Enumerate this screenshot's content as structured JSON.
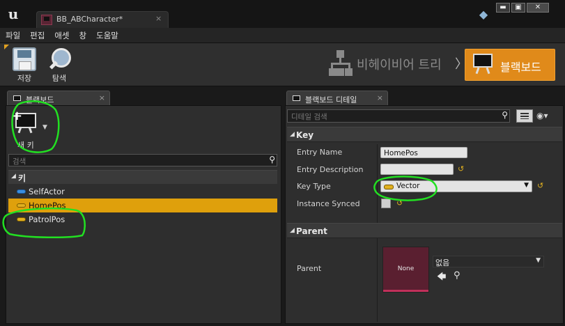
{
  "window": {
    "tab_title": "BB_ABCharacter*",
    "tab_close": "×",
    "logo": "u",
    "controls": [
      "▬",
      "▣",
      "✕"
    ]
  },
  "menu": [
    "파일",
    "편집",
    "애셋",
    "창",
    "도움말"
  ],
  "toolbar": {
    "save_label": "저장",
    "find_label": "탐색",
    "mode_behavior_tree": "비헤이비어 트리",
    "mode_separator": "〉",
    "mode_blackboard": "블랙보드"
  },
  "blackboard_panel": {
    "tab_label": "블랙보드",
    "tab_close": "×",
    "new_key_label": "새 키",
    "search_placeholder": "검색",
    "category_label": "키",
    "keys": [
      {
        "name": "SelfActor",
        "type_color": "#3a8ee0",
        "selected": false
      },
      {
        "name": "HomePos",
        "type_color": "#e0b020",
        "selected": true
      },
      {
        "name": "PatrolPos",
        "type_color": "#e0b020",
        "selected": false
      }
    ]
  },
  "details_panel": {
    "tab_label": "블랙보드 디테일",
    "tab_close": "×",
    "search_placeholder": "디테일 검색",
    "key_section": {
      "title": "Key",
      "entry_name_label": "Entry Name",
      "entry_name_value": "HomePos",
      "entry_description_label": "Entry Description",
      "entry_description_value": "",
      "key_type_label": "Key Type",
      "key_type_value": "Vector",
      "instance_synced_label": "Instance Synced",
      "instance_synced_checked": false
    },
    "parent_section": {
      "title": "Parent",
      "parent_label": "Parent",
      "thumbnail_text": "None",
      "parent_value": "없음"
    }
  },
  "colors": {
    "accent_orange": "#e08a1a",
    "selection_yellow": "#dfa00c",
    "annotation_green": "#22e022"
  }
}
